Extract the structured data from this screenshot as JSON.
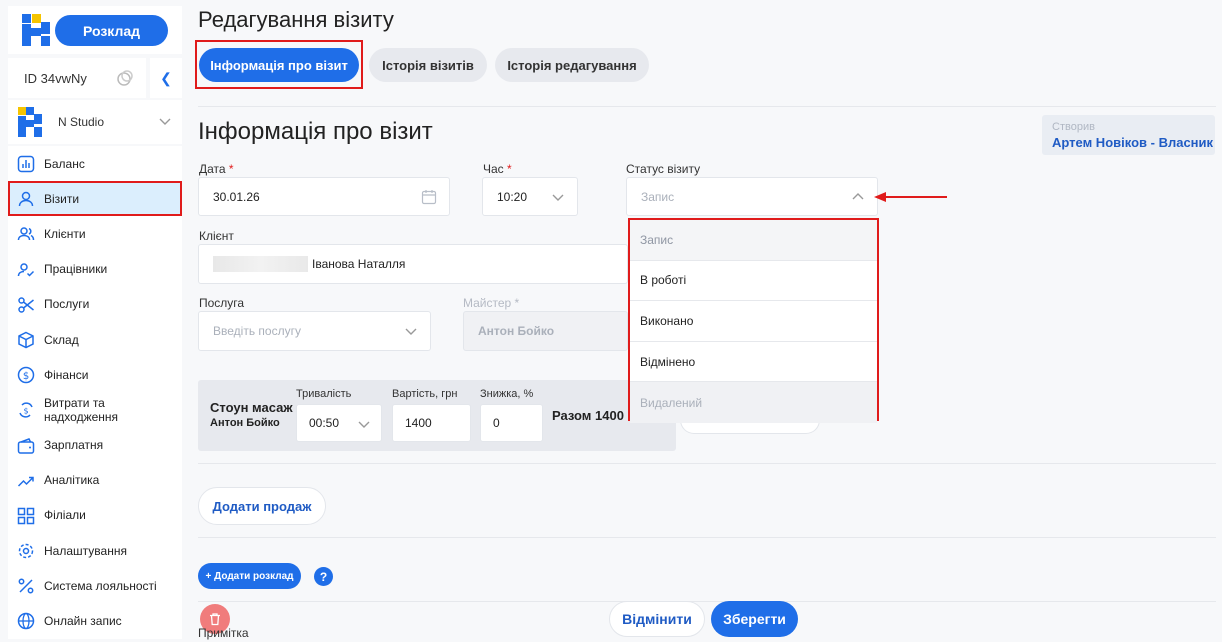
{
  "sidebar": {
    "schedule_button": "Розклад",
    "account_id": "ID 34vwNy",
    "studio_name": "N Studio",
    "items": [
      {
        "label": "Баланс",
        "icon": "balance-chart-icon"
      },
      {
        "label": "Візити",
        "icon": "user-icon"
      },
      {
        "label": "Клієнти",
        "icon": "users-icon"
      },
      {
        "label": "Працівники",
        "icon": "user-check-icon"
      },
      {
        "label": "Послуги",
        "icon": "scissors-icon"
      },
      {
        "label": "Склад",
        "icon": "box-icon"
      },
      {
        "label": "Фінанси",
        "icon": "dollar-circle-icon"
      },
      {
        "label": "Витрати та надходження",
        "icon": "money-flow-icon"
      },
      {
        "label": "Зарплатня",
        "icon": "wallet-icon"
      },
      {
        "label": "Аналітика",
        "icon": "trend-icon"
      },
      {
        "label": "Філіали",
        "icon": "grid-icon"
      },
      {
        "label": "Налаштування",
        "icon": "gear-icon"
      },
      {
        "label": "Система лояльності",
        "icon": "percent-icon"
      },
      {
        "label": "Онлайн запис",
        "icon": "globe-icon"
      }
    ]
  },
  "header": {
    "title": "Редагування візиту",
    "tabs": [
      "Інформація про візит",
      "Історія візитів",
      "Історія редагування"
    ]
  },
  "main": {
    "section_title": "Інформація про візит",
    "created": {
      "label": "Створив",
      "value": "Артем Новіков - Власник"
    },
    "date": {
      "label": "Дата",
      "value": "30.01.26"
    },
    "time": {
      "label": "Час",
      "value": "10:20"
    },
    "status": {
      "label": "Статус візиту",
      "placeholder": "Запис"
    },
    "status_options": [
      "Запис",
      "В роботі",
      "Виконано",
      "Відмінено",
      "Видалений"
    ],
    "client": {
      "label": "Клієнт",
      "value": "Іванова Наталля"
    },
    "service": {
      "label": "Послуга",
      "placeholder": "Введіть послугу"
    },
    "master": {
      "label": "Майстер",
      "value": "Антон Бойко"
    },
    "service_item": {
      "name": "Стоун масаж",
      "master": "Антон Бойко",
      "duration_label": "Тривалість",
      "duration": "00:50",
      "price_label": "Вартість, грн",
      "price": "1400",
      "discount_label": "Знижка, %",
      "discount": "0",
      "total": "Разом 1400"
    },
    "add_sale": "Додати продаж",
    "add_schedule": "+ Додати розклад",
    "help": "?",
    "note_label": "Примітка",
    "cancel": "Відмінити",
    "save": "Зберегти"
  },
  "colors": {
    "accent": "#1f6ee8",
    "highlight": "#e01b1b",
    "active_nav_bg": "#dbeefd"
  }
}
